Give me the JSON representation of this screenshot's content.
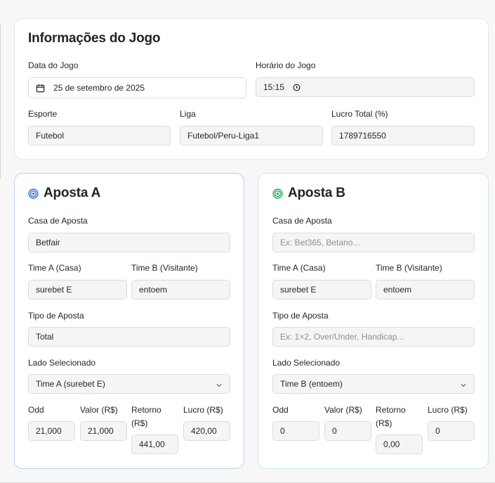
{
  "info": {
    "title": "Informações do Jogo",
    "date_label": "Data do Jogo",
    "date_value": "25 de setembro de 2025",
    "time_label": "Horário do Jogo",
    "time_value": "15:15",
    "sport_label": "Esporte",
    "sport_value": "Futebol",
    "league_label": "Liga",
    "league_value": "Futebol/Peru-Liga1",
    "profit_label": "Lucro Total (%)",
    "profit_value": "1789716550"
  },
  "bet_a": {
    "title": "Aposta A",
    "accent": "#2f6bc4",
    "house_label": "Casa de Aposta",
    "house_value": "Betfair",
    "team_a_label": "Time A (Casa)",
    "team_a_value": "surebet E",
    "team_b_label": "Time B (Visitante)",
    "team_b_value": "entoem",
    "type_label": "Tipo de Aposta",
    "type_value": "Total",
    "side_label": "Lado Selecionado",
    "side_value": "Time A (surebet E)",
    "odd_label": "Odd",
    "odd_value": "21,000",
    "stake_label": "Valor (R$)",
    "stake_value": "21,000",
    "return_label_1": "Retorno",
    "return_label_2": "(R$)",
    "return_value": "441,00",
    "profit_label": "Lucro (R$)",
    "profit_value": "420,00"
  },
  "bet_b": {
    "title": "Aposta B",
    "accent": "#22a55a",
    "house_label": "Casa de Aposta",
    "house_placeholder": "Ex: Bet365, Betano...",
    "team_a_label": "Time A (Casa)",
    "team_a_value": "surebet E",
    "team_b_label": "Time B (Visitante)",
    "team_b_value": "entoem",
    "type_label": "Tipo de Aposta",
    "type_placeholder": "Ex: 1×2, Over/Under, Handicap...",
    "side_label": "Lado Selecionado",
    "side_value": "Time B (entoem)",
    "odd_label": "Odd",
    "odd_value": "0",
    "stake_label": "Valor (R$)",
    "stake_value": "0",
    "return_label_1": "Retorno",
    "return_label_2": "(R$)",
    "return_value": "0,00",
    "profit_label": "Lucro (R$)",
    "profit_value": "0"
  },
  "icons": {
    "date": "calendar-icon",
    "time": "clock-icon",
    "bet_a": "target-icon",
    "bet_b": "target-icon",
    "select": "chevron-down-icon"
  }
}
